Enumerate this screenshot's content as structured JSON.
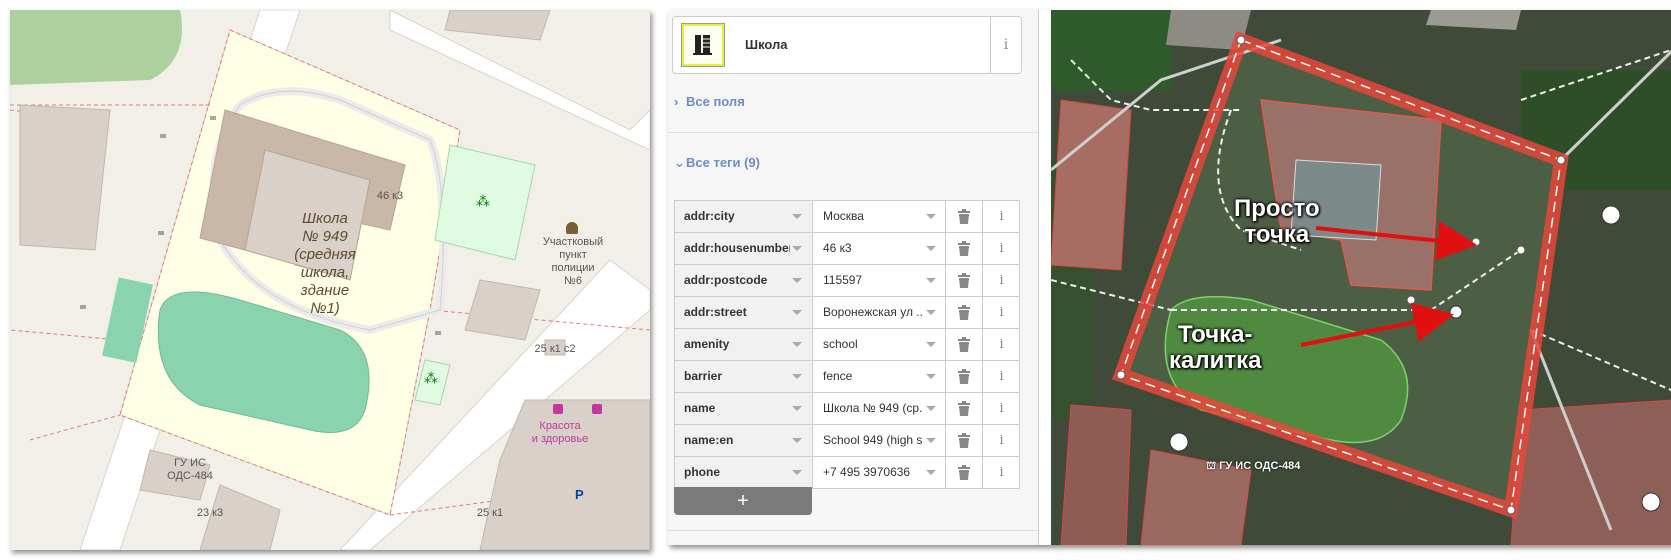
{
  "left_map": {
    "school_label": "Школа\n№ 949\n(средняя\nшкола,\nздание\n№1)",
    "building_number": "46 к3",
    "police_label": "Участковый\nпункт\nполиции\n№6",
    "building_25k1c2": "25 к1 с2",
    "shop_label": "Красота\nи здоровье",
    "gu_label": "ГУ ИС\nОДС-484",
    "building_23k3": "23 к3",
    "building_25k1": "25 к1"
  },
  "sidebar": {
    "preset_name": "Школа",
    "info_glyph": "i",
    "all_fields": "Все поля",
    "all_tags": "Все теги (9)",
    "add_button": "+",
    "tags": [
      {
        "key": "addr:city",
        "value": "Москва"
      },
      {
        "key": "addr:housenumber",
        "value": "46 к3"
      },
      {
        "key": "addr:postcode",
        "value": "115597"
      },
      {
        "key": "addr:street",
        "value": "Воронежская ул ..."
      },
      {
        "key": "amenity",
        "value": "school"
      },
      {
        "key": "barrier",
        "value": "fence"
      },
      {
        "key": "name",
        "value": "Школа № 949 (ср..."
      },
      {
        "key": "name:en",
        "value": "School 949 (high s..."
      },
      {
        "key": "phone",
        "value": "+7 495 3970636"
      }
    ]
  },
  "satellite": {
    "annotation_point": "Просто\nточка",
    "annotation_gate": "Точка-\nкалитка",
    "gu_label": "ГУ ИС ОДС-484",
    "fence_color": "#e8473b",
    "arrow_color": "#e01010"
  }
}
